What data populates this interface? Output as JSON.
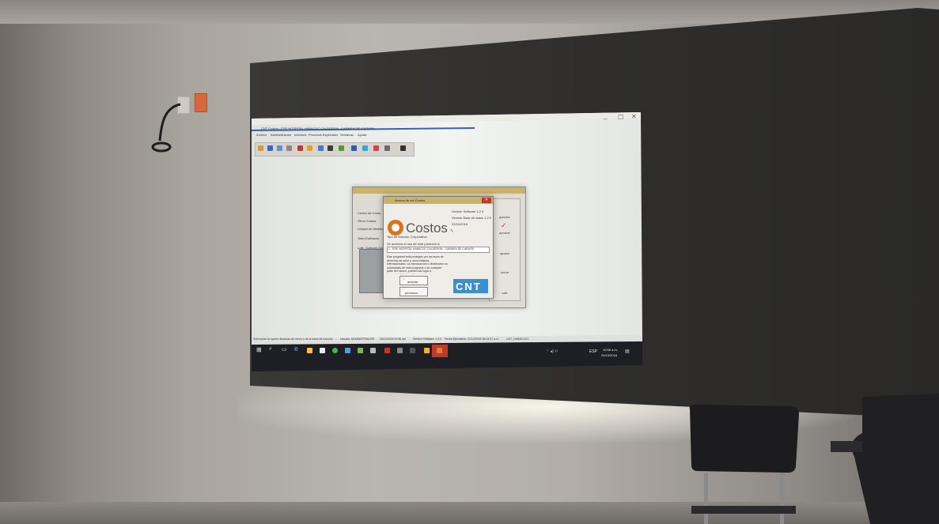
{
  "window": {
    "title": "CNT Costos - ESE HOSPITAL HABACUC CALDERON - CARMEN DE CARUPA",
    "menu": [
      "Archivo",
      "Administración",
      "Informes",
      "Procesos Especiales",
      "Ventanas",
      "Ayuda"
    ],
    "controls": [
      "–",
      "☐",
      "✕"
    ]
  },
  "about_dialog": {
    "title": "Acerca de cnt-Costos",
    "logo_text": "Costos",
    "version_software": "Versión Software 1.2.0",
    "version_db": "Versión Base de datos 1.2.0",
    "date": "22/10/2018",
    "license_type": "Tipo de licencia: Corporativa",
    "authorized_label": "Se autoriza el uso de este producto a:",
    "licensee": "1 - ESE HOSPITAL HABACUC CALDERON - CARMEN DE CARUPA",
    "legal_text": "Este programa está protegido por las leyes de derechos de autor y otros tratados internacionales. La reproducción o distribución no autorizadas de este programa o de cualquier parte del mismo, pueden dar lugar a responsabilidades civiles y criminales.",
    "accept_label": "aceptar",
    "more_label": "permisos",
    "brand": "CNT"
  },
  "back_dialog": {
    "fields": [
      "Centro de Costo",
      "Otros Costos",
      "Unidad de Medida",
      "Valor Estimado",
      "Lote",
      "Subtotal Costo"
    ],
    "buttons": [
      "guardar",
      "aprobar",
      "ajustar",
      "cerrar",
      "salir"
    ]
  },
  "status_bar": {
    "hint": "Seleccione la opción deseada del menú o de la barra de botones",
    "user": "Usuario: ADMINISTRADOR",
    "login": "26/10/2018 10:56 am",
    "software_version": "Versión Software: 1.2.0",
    "executable_date": "Fecha Ejecutable: 22/10/2018 08:43:37 a.m.",
    "app": "CNT_HABACUCC"
  },
  "taskbar": {
    "lang": "ESP",
    "time": "10:56 a.m.",
    "date": "26/10/2018"
  },
  "colors": {
    "screen": "#e9ece8",
    "screen_frame": "#2e2d2b",
    "dialog_title": "#c9b36b",
    "costos_orange": "#d9731c",
    "cnt_blue": "#3b8fcf",
    "taskbar": "#1d1f25"
  }
}
